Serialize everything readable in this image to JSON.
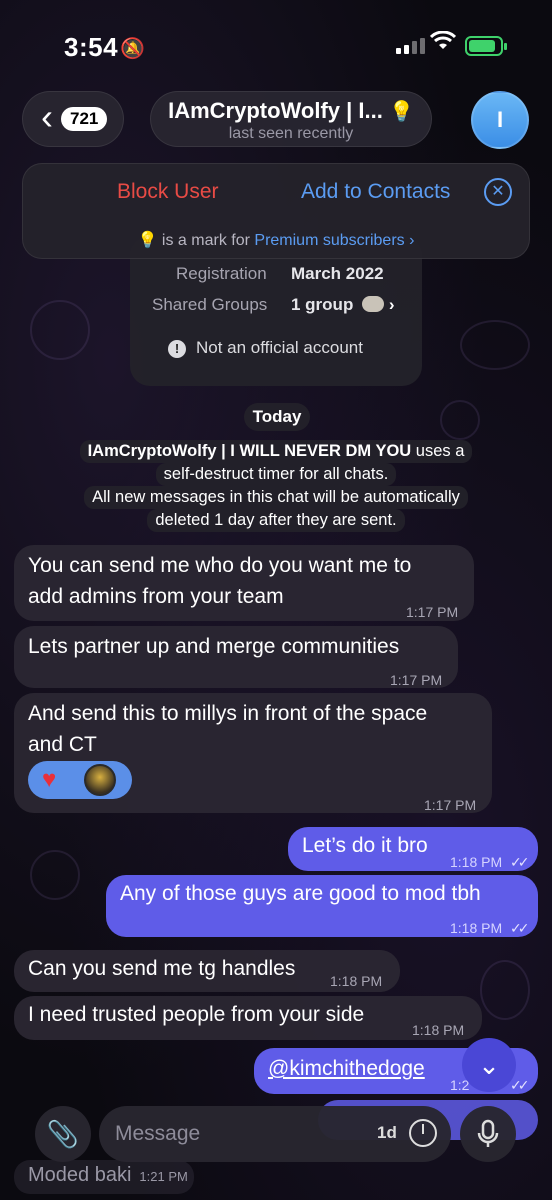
{
  "status_bar": {
    "time": "3:54"
  },
  "nav": {
    "back_count": "721",
    "title": "IAmCryptoWolfy | I...",
    "subtitle": "last seen recently",
    "avatar_letter": "I"
  },
  "action_panel": {
    "block_label": "Block User",
    "add_label": "Add to Contacts",
    "premium_text": "is a mark for",
    "premium_link": "Premium subscribers"
  },
  "info_card": {
    "registration_label": "Registration",
    "registration_value": "March 2022",
    "groups_label": "Shared Groups",
    "groups_value": "1 group",
    "official_text": "Not an official account"
  },
  "date_chip": "Today",
  "service": {
    "name": "IAmCryptoWolfy | I WILL NEVER DM YOU",
    "line1_rest": "uses a",
    "line2": "self-destruct timer for all chats.",
    "line3": "All new messages in this chat will be automatically",
    "line4": "deleted 1 day after they are sent."
  },
  "messages": [
    {
      "dir": "in",
      "lines": [
        "You can send me who do you want me to",
        "add admins from your team"
      ],
      "time": "1:17 PM"
    },
    {
      "dir": "in",
      "lines": [
        "Lets partner up and merge communities"
      ],
      "time": "1:17 PM"
    },
    {
      "dir": "in",
      "lines": [
        "And send this to millys in front of the space",
        "and CT"
      ],
      "time": "1:17 PM"
    },
    {
      "dir": "out",
      "lines": [
        "Let’s do it bro"
      ],
      "time": "1:18 PM"
    },
    {
      "dir": "out",
      "lines": [
        "Any of those guys are good to mod tbh"
      ],
      "time": "1:18 PM"
    },
    {
      "dir": "in",
      "lines": [
        "Can you send me tg handles"
      ],
      "time": "1:18 PM"
    },
    {
      "dir": "in",
      "lines": [
        "I need trusted people from your side"
      ],
      "time": "1:18 PM"
    },
    {
      "dir": "out",
      "lines": [
        "@kimchithedoge"
      ],
      "time": "1:2"
    },
    {
      "dir": "in",
      "lines": [
        "Moded baki"
      ],
      "time": "1:21 PM"
    }
  ],
  "input": {
    "placeholder": "Message",
    "timer": "1d"
  },
  "colors": {
    "outgoing": "#5f5ce8",
    "incoming": "#2a2632",
    "danger": "#e84b45",
    "link": "#5b9cf2"
  }
}
